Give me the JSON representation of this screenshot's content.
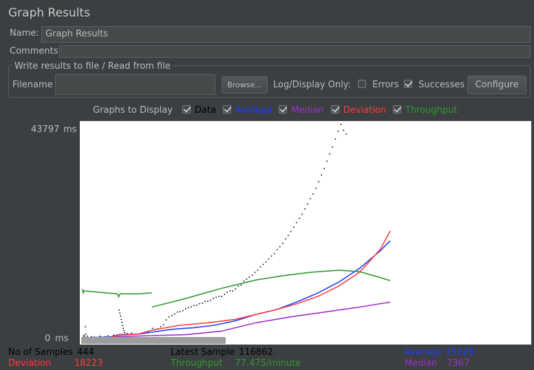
{
  "title": "Graph Results",
  "name": {
    "label": "Name:",
    "value": "Graph Results"
  },
  "comments": {
    "label": "Comments:",
    "value": ""
  },
  "file_group": {
    "title": "Write results to file / Read from file",
    "filename_label": "Filename",
    "filename_value": "",
    "browse_label": "Browse...",
    "log_display_label": "Log/Display Only:",
    "errors": {
      "label": "Errors",
      "checked": false
    },
    "successes": {
      "label": "Successes",
      "checked": true
    },
    "configure_label": "Configure"
  },
  "graphs_to_display": {
    "label": "Graphs to Display",
    "options": [
      {
        "label": "Data",
        "checked": true,
        "color": "#000000"
      },
      {
        "label": "Average",
        "checked": true,
        "color": "#1a3cff"
      },
      {
        "label": "Median",
        "checked": true,
        "color": "#9b2fc9"
      },
      {
        "label": "Deviation",
        "checked": true,
        "color": "#ff3b3b"
      },
      {
        "label": "Throughput",
        "checked": true,
        "color": "#2e9a2e"
      }
    ]
  },
  "chart_data": {
    "type": "scatter",
    "y_max_label": "43797",
    "y_min_label": "0",
    "y_unit": "ms",
    "ylim": [
      0,
      43797
    ],
    "x_count": 444,
    "grid": false,
    "series": [
      {
        "name": "Data",
        "color": "#000000",
        "kind": "points",
        "points": [
          [
            0,
            500
          ],
          [
            1,
            900
          ],
          [
            2,
            700
          ],
          [
            3,
            2600
          ],
          [
            4,
            1100
          ],
          [
            6,
            700
          ],
          [
            8,
            400
          ],
          [
            12,
            600
          ],
          [
            16,
            500
          ],
          [
            20,
            400
          ],
          [
            24,
            700
          ],
          [
            28,
            500
          ],
          [
            32,
            600
          ],
          [
            36,
            800
          ],
          [
            40,
            600
          ],
          [
            44,
            900
          ],
          [
            48,
            700
          ],
          [
            52,
            6000
          ],
          [
            53,
            5400
          ],
          [
            54,
            4800
          ],
          [
            55,
            4100
          ],
          [
            56,
            3500
          ],
          [
            57,
            2900
          ],
          [
            58,
            2300
          ],
          [
            59,
            1800
          ],
          [
            60,
            1400
          ],
          [
            64,
            1200
          ],
          [
            70,
            1300
          ],
          [
            76,
            1100
          ],
          [
            82,
            1200
          ],
          [
            88,
            1400
          ],
          [
            94,
            1600
          ],
          [
            100,
            2300
          ],
          [
            104,
            2100
          ],
          [
            108,
            2200
          ],
          [
            112,
            2600
          ],
          [
            116,
            3000
          ],
          [
            120,
            4000
          ],
          [
            124,
            4600
          ],
          [
            128,
            4900
          ],
          [
            132,
            5200
          ],
          [
            136,
            5600
          ],
          [
            140,
            5700
          ],
          [
            144,
            5900
          ],
          [
            148,
            6300
          ],
          [
            152,
            6500
          ],
          [
            156,
            6700
          ],
          [
            160,
            6900
          ],
          [
            164,
            7000
          ],
          [
            168,
            7300
          ],
          [
            172,
            7400
          ],
          [
            176,
            7800
          ],
          [
            180,
            7800
          ],
          [
            184,
            8000
          ],
          [
            188,
            8400
          ],
          [
            192,
            8600
          ],
          [
            196,
            8800
          ],
          [
            200,
            8800
          ],
          [
            204,
            9200
          ],
          [
            208,
            9600
          ],
          [
            212,
            9900
          ],
          [
            216,
            9900
          ],
          [
            220,
            10300
          ],
          [
            224,
            10900
          ],
          [
            228,
            11100
          ],
          [
            232,
            11900
          ],
          [
            236,
            12300
          ],
          [
            240,
            12700
          ],
          [
            244,
            13100
          ],
          [
            248,
            13700
          ],
          [
            252,
            14100
          ],
          [
            256,
            14800
          ],
          [
            260,
            15300
          ],
          [
            264,
            15800
          ],
          [
            268,
            16400
          ],
          [
            272,
            17000
          ],
          [
            276,
            17500
          ],
          [
            280,
            18300
          ],
          [
            284,
            18900
          ],
          [
            288,
            19600
          ],
          [
            292,
            20500
          ],
          [
            296,
            21200
          ],
          [
            300,
            22000
          ],
          [
            304,
            22900
          ],
          [
            308,
            23800
          ],
          [
            312,
            24700
          ],
          [
            316,
            25500
          ],
          [
            320,
            26600
          ],
          [
            324,
            27600
          ],
          [
            328,
            28700
          ],
          [
            332,
            29600
          ],
          [
            336,
            30800
          ],
          [
            340,
            32100
          ],
          [
            344,
            33500
          ],
          [
            348,
            34800
          ],
          [
            352,
            36300
          ],
          [
            356,
            37800
          ],
          [
            360,
            39200
          ],
          [
            364,
            40800
          ],
          [
            368,
            42400
          ],
          [
            372,
            43800
          ],
          [
            376,
            42600
          ],
          [
            380,
            41800
          ]
        ]
      },
      {
        "name": "Average",
        "color": "#1a3cff",
        "kind": "line",
        "points": [
          [
            0,
            300
          ],
          [
            40,
            400
          ],
          [
            52,
            900
          ],
          [
            80,
            1000
          ],
          [
            100,
            1400
          ],
          [
            130,
            2000
          ],
          [
            160,
            2300
          ],
          [
            190,
            2800
          ],
          [
            220,
            3700
          ],
          [
            250,
            5000
          ],
          [
            280,
            6000
          ],
          [
            310,
            7600
          ],
          [
            340,
            9400
          ],
          [
            370,
            11600
          ],
          [
            400,
            14400
          ],
          [
            430,
            18000
          ],
          [
            444,
            20000
          ]
        ]
      },
      {
        "name": "Median",
        "color": "#9b2fc9",
        "kind": "line",
        "points": [
          [
            0,
            200
          ],
          [
            40,
            250
          ],
          [
            52,
            500
          ],
          [
            100,
            700
          ],
          [
            150,
            900
          ],
          [
            200,
            1600
          ],
          [
            250,
            3300
          ],
          [
            300,
            4500
          ],
          [
            350,
            5500
          ],
          [
            400,
            6500
          ],
          [
            430,
            7200
          ],
          [
            444,
            7500
          ]
        ]
      },
      {
        "name": "Deviation",
        "color": "#ff3b3b",
        "kind": "line",
        "points": [
          [
            0,
            200
          ],
          [
            40,
            300
          ],
          [
            52,
            800
          ],
          [
            80,
            1000
          ],
          [
            100,
            1800
          ],
          [
            140,
            2800
          ],
          [
            180,
            3300
          ],
          [
            220,
            4000
          ],
          [
            250,
            5000
          ],
          [
            280,
            6000
          ],
          [
            310,
            7200
          ],
          [
            340,
            8700
          ],
          [
            370,
            10800
          ],
          [
            400,
            13600
          ],
          [
            430,
            18300
          ],
          [
            444,
            22000
          ]
        ]
      },
      {
        "name": "Throughput",
        "color": "#2e9a2e",
        "kind": "line",
        "points": [
          [
            0,
            10200
          ],
          [
            1,
            9400
          ],
          [
            2,
            9800
          ],
          [
            50,
            9200
          ],
          [
            52,
            8600
          ],
          [
            54,
            9200
          ],
          [
            80,
            9200
          ],
          [
            100,
            9400
          ]
        ],
        "break_after": true
      },
      {
        "name": "Throughput",
        "color": "#2e9a2e",
        "kind": "line",
        "points": [
          [
            100,
            6500
          ],
          [
            150,
            8300
          ],
          [
            200,
            10300
          ],
          [
            250,
            12000
          ],
          [
            290,
            12900
          ],
          [
            330,
            13600
          ],
          [
            370,
            14000
          ],
          [
            400,
            13700
          ],
          [
            430,
            12500
          ],
          [
            444,
            11900
          ]
        ]
      }
    ]
  },
  "stats": {
    "samples_label": "No of Samples",
    "samples_value": "444",
    "latest_label": "Latest Sample",
    "latest_value": "116862",
    "average_label": "Average",
    "average_value": "15628",
    "deviation_label": "Deviation",
    "deviation_value": "18223",
    "throughput_label": "Throughput",
    "throughput_value": "77.475/minute",
    "median_label": "Median",
    "median_value": "7367",
    "colors": {
      "samples": "#000000",
      "latest": "#000000",
      "average": "#1a3cff",
      "deviation": "#ff3b3b",
      "throughput": "#2e9a2e",
      "median": "#9b2fc9"
    }
  }
}
